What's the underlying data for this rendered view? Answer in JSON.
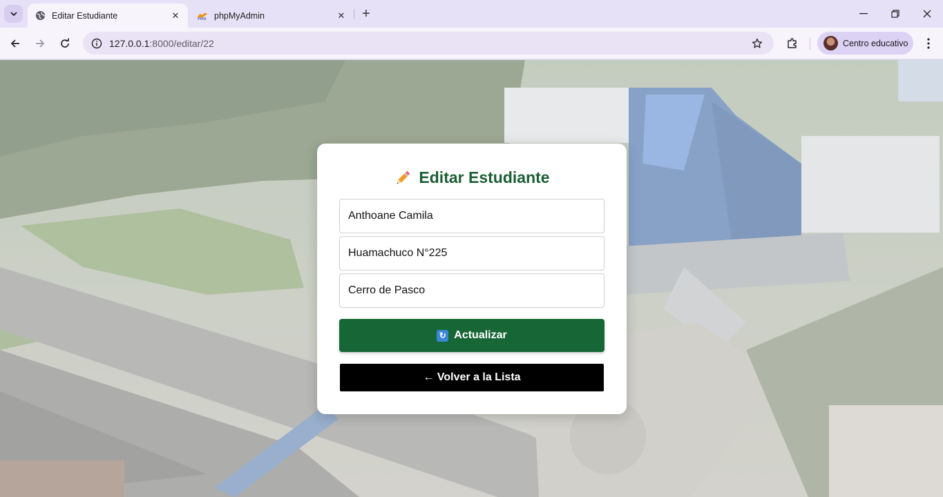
{
  "browser": {
    "tabs": [
      {
        "title": "Editar Estudiante",
        "favicon": "globe-icon",
        "active": true
      },
      {
        "title": "phpMyAdmin",
        "favicon": "phpmyadmin-icon",
        "active": false
      }
    ],
    "url_host": "127.0.0.1",
    "url_rest": ":8000/editar/22",
    "profile_name": "Centro educativo"
  },
  "form": {
    "heading": "Editar Estudiante",
    "heading_icon": "pencil-icon",
    "fields": {
      "nombre": "Anthoane Camila",
      "direccion": "Huamachuco N°225",
      "ciudad": "Cerro de Pasco"
    },
    "update_button": "Actualizar",
    "update_icon": "refresh-icon",
    "back_button": "← Volver a la Lista"
  },
  "colors": {
    "primary_green": "#176736",
    "heading_green": "#1b5e34",
    "back_button": "#000000",
    "browser_frame": "#e7e1f7"
  }
}
